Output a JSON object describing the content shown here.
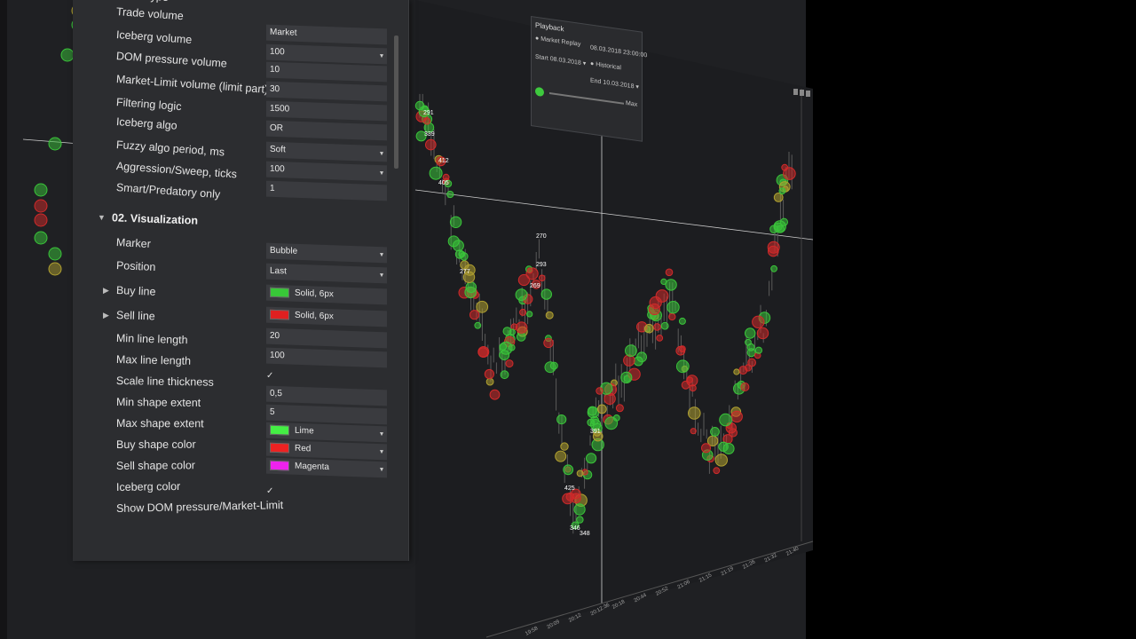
{
  "properties": {
    "partial_top_label": "Order type",
    "rows": [
      {
        "label": "Trade volume",
        "value": "Market",
        "dropdown": false
      },
      {
        "label": "Iceberg volume",
        "value": "100",
        "dropdown": true
      },
      {
        "label": "DOM pressure volume",
        "value": "10",
        "dropdown": false
      },
      {
        "label": "Market-Limit volume (limit part)",
        "value": "30",
        "dropdown": false
      },
      {
        "label": "Filtering logic",
        "value": "1500",
        "dropdown": false
      },
      {
        "label": "Iceberg algo",
        "value": "OR",
        "dropdown": false
      },
      {
        "label": "Fuzzy algo period, ms",
        "value": "Soft",
        "dropdown": true
      },
      {
        "label": "Aggression/Sweep, ticks",
        "value": "100",
        "dropdown": true
      },
      {
        "label": "Smart/Predatory only",
        "value": "1",
        "dropdown": false
      }
    ],
    "section_title": "02. Visualization",
    "viz_rows": [
      {
        "label": "Marker",
        "value": "Bubble",
        "dropdown": true
      },
      {
        "label": "Position",
        "value": "Last",
        "dropdown": true
      },
      {
        "label": "Buy line",
        "value": "Solid, 6px",
        "swatch": "#38c838",
        "expandable": true
      },
      {
        "label": "Sell line",
        "value": "Solid, 6px",
        "swatch": "#e02020",
        "expandable": true
      },
      {
        "label": "Min line length",
        "value": "20"
      },
      {
        "label": "Max line length",
        "value": "100"
      },
      {
        "label": "Scale line thickness",
        "value": "✓"
      },
      {
        "label": "Min shape extent",
        "value": "0,5"
      },
      {
        "label": "Max shape extent",
        "value": "5"
      },
      {
        "label": "Buy shape color",
        "value": "Lime",
        "swatch": "#44ee44",
        "dropdown": true
      },
      {
        "label": "Sell shape color",
        "value": "Red",
        "swatch": "#ee2222",
        "dropdown": true
      },
      {
        "label": "Iceberg color",
        "value": "Magenta",
        "swatch": "#ee22ee",
        "dropdown": true
      },
      {
        "label": "Show DOM pressure/Market-Limit",
        "value": "✓"
      }
    ]
  },
  "playback": {
    "title": "Playback",
    "market_replay": "Market Replay",
    "historical": "Historical",
    "timestamp": "08.03.2018 23:00:00",
    "start_label": "Start",
    "start_value": "08.03.2018",
    "end_label": "End",
    "end_value": "10.03.2018",
    "max_label": "Max"
  },
  "chart": {
    "bubble_labels": [
      "291",
      "339",
      "412",
      "405",
      "277",
      "270",
      "293",
      "269",
      "425",
      "391",
      "346",
      "348"
    ],
    "time_labels": [
      "19:58",
      "20:09",
      "20:12",
      "20:12:36",
      "20:18",
      "20:44",
      "20:52",
      "21:06",
      "21:15",
      "21:19",
      "21:26",
      "21:32",
      "21:40"
    ],
    "colors": {
      "buy": "#3ac43a",
      "sell": "#d02a2a",
      "neutral": "#b0a030",
      "bg": "#1f2023"
    }
  }
}
